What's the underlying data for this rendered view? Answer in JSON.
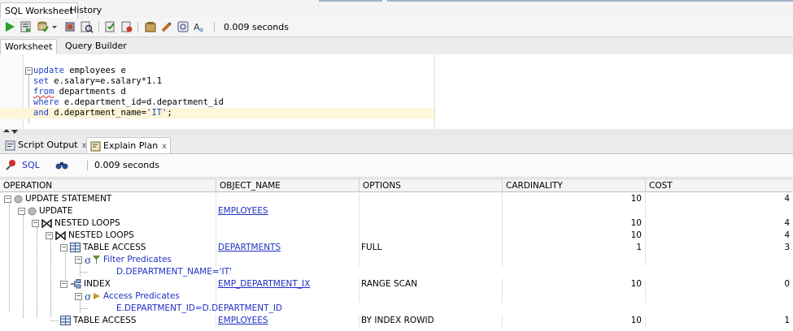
{
  "top_tabs": [
    {
      "label": "SQL Worksheet",
      "active": true
    },
    {
      "label": "History",
      "active": false
    }
  ],
  "toolbar": {
    "icons": [
      "run-statement-icon",
      "run-script-icon",
      "commit-icon",
      "dropdown-arrow-icon",
      "rollback-icon",
      "explain-plan-icon",
      "autotrace-icon",
      "sql-tuning-icon",
      "clear-icon",
      "history-icon",
      "format-icon"
    ],
    "elapsed": "0.009 seconds"
  },
  "inner_tabs": [
    {
      "label": "Worksheet",
      "active": true
    },
    {
      "label": "Query Builder",
      "active": false
    }
  ],
  "editor": {
    "lines": [
      {
        "keyword": "update",
        "rest": " employees e"
      },
      {
        "keyword": "set",
        "rest": " e.salary=e.salary*1.1"
      },
      {
        "keyword": "from",
        "rest": " departments d"
      },
      {
        "keyword": "where",
        "rest": " e.department_id=d.department_id"
      },
      {
        "keyword": "and",
        "rest": " d.department_name=",
        "string": "'IT'",
        "tail": ";"
      }
    ]
  },
  "bottom_tabs": [
    {
      "label": "Script Output",
      "active": false
    },
    {
      "label": "Explain Plan",
      "active": true
    }
  ],
  "plan_toolbar": {
    "sql_label": "SQL",
    "elapsed": "0.009 seconds"
  },
  "grid": {
    "columns": [
      "OPERATION",
      "OBJECT_NAME",
      "OPTIONS",
      "CARDINALITY",
      "COST"
    ],
    "rows": [
      {
        "operation": "UPDATE STATEMENT",
        "object": "",
        "options": "",
        "cardinality": "10",
        "cost": "4"
      },
      {
        "operation": "UPDATE",
        "object": "EMPLOYEES",
        "options": "",
        "cardinality": "",
        "cost": ""
      },
      {
        "operation": "NESTED LOOPS",
        "object": "",
        "options": "",
        "cardinality": "10",
        "cost": "4"
      },
      {
        "operation": "NESTED LOOPS",
        "object": "",
        "options": "",
        "cardinality": "10",
        "cost": "4"
      },
      {
        "operation": "TABLE ACCESS",
        "object": "DEPARTMENTS",
        "options": "FULL",
        "cardinality": "1",
        "cost": "3"
      },
      {
        "operation": "Filter Predicates",
        "object": "",
        "options": "",
        "cardinality": "",
        "cost": ""
      },
      {
        "operation": "D.DEPARTMENT_NAME='IT'",
        "object": "",
        "options": "",
        "cardinality": "",
        "cost": ""
      },
      {
        "operation": "INDEX",
        "object": "EMP_DEPARTMENT_IX",
        "options": "RANGE SCAN",
        "cardinality": "10",
        "cost": "0"
      },
      {
        "operation": "Access Predicates",
        "object": "",
        "options": "",
        "cardinality": "",
        "cost": ""
      },
      {
        "operation": "E.DEPARTMENT_ID=D.DEPARTMENT_ID",
        "object": "",
        "options": "",
        "cardinality": "",
        "cost": ""
      },
      {
        "operation": "TABLE ACCESS",
        "object": "EMPLOYEES",
        "options": "BY INDEX ROWID",
        "cardinality": "10",
        "cost": "1"
      }
    ]
  },
  "colors": {
    "keyword": "#1e43c6",
    "link": "#1f2fc4"
  }
}
